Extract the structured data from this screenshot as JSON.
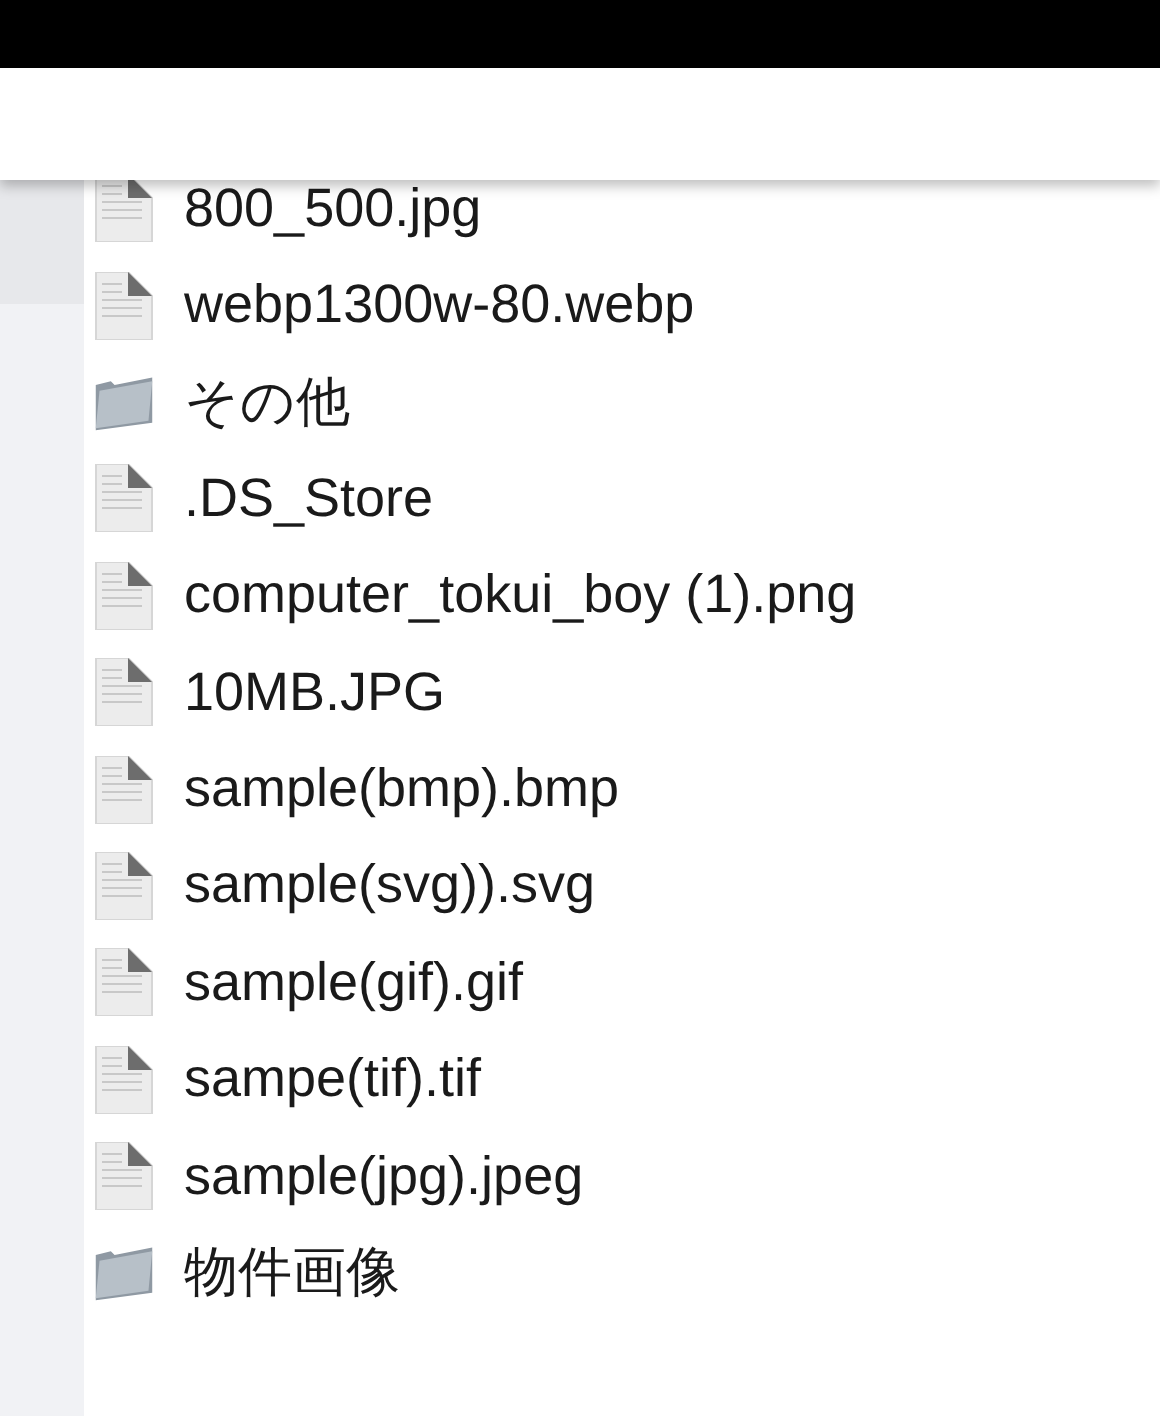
{
  "files": [
    {
      "kind": "file",
      "name": "800_500.jpg"
    },
    {
      "kind": "file",
      "name": "webp1300w-80.webp"
    },
    {
      "kind": "folder",
      "name": "その他"
    },
    {
      "kind": "file",
      "name": ".DS_Store"
    },
    {
      "kind": "file",
      "name": "computer_tokui_boy (1).png"
    },
    {
      "kind": "file",
      "name": "10MB.JPG"
    },
    {
      "kind": "file",
      "name": "sample(bmp).bmp"
    },
    {
      "kind": "file",
      "name": "sample(svg)).svg"
    },
    {
      "kind": "file",
      "name": "sample(gif).gif"
    },
    {
      "kind": "file",
      "name": "sampe(tif).tif"
    },
    {
      "kind": "file",
      "name": "sample(jpg).jpeg"
    },
    {
      "kind": "folder",
      "name": "物件画像"
    }
  ]
}
